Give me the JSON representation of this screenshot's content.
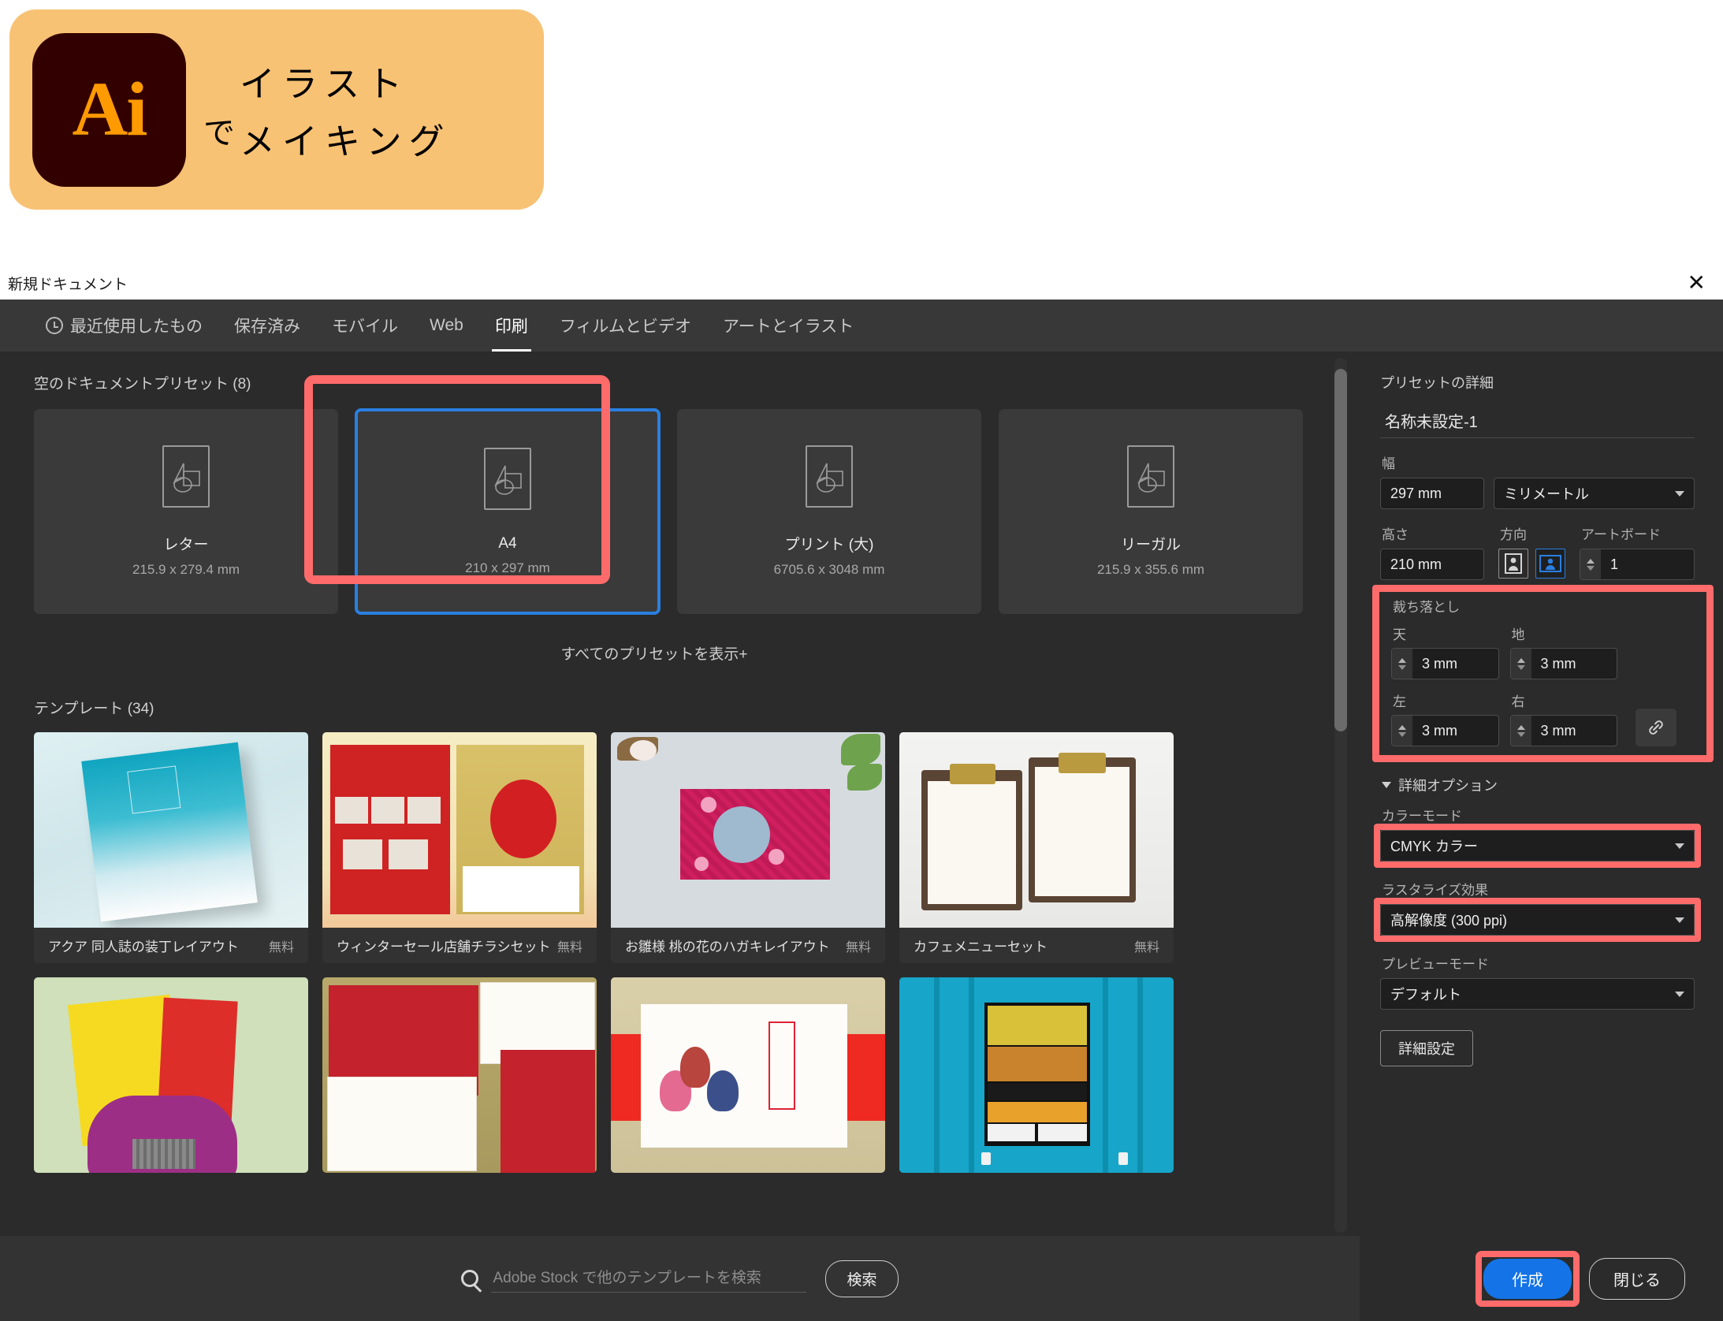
{
  "banner": {
    "logo_text": "Ai",
    "particle": "で",
    "line1": "イラスト",
    "line2": "メイキング",
    "bg_color": "#f8c274",
    "logo_bg": "#330000",
    "logo_fg": "#ff9a00"
  },
  "dialog": {
    "title": "新規ドキュメント",
    "close_icon": "✕"
  },
  "tabs": [
    {
      "label": "最近使用したもの",
      "icon": "clock-icon",
      "active": false
    },
    {
      "label": "保存済み",
      "active": false
    },
    {
      "label": "モバイル",
      "active": false
    },
    {
      "label": "Web",
      "active": false
    },
    {
      "label": "印刷",
      "active": true
    },
    {
      "label": "フィルムとビデオ",
      "active": false
    },
    {
      "label": "アートとイラスト",
      "active": false
    }
  ],
  "presets": {
    "heading": "空のドキュメントプリセット (8)",
    "show_all": "すべてのプリセットを表示+",
    "items": [
      {
        "name": "レター",
        "size": "215.9 x 279.4 mm",
        "selected": false
      },
      {
        "name": "A4",
        "size": "210 x 297 mm",
        "selected": true
      },
      {
        "name": "プリント (大)",
        "size": "6705.6 x 3048 mm",
        "selected": false
      },
      {
        "name": "リーガル",
        "size": "215.9 x 355.6 mm",
        "selected": false
      }
    ]
  },
  "templates": {
    "heading": "テンプレート (34)",
    "row1": [
      {
        "title": "アクア 同人誌の装丁レイアウト",
        "price": "無料"
      },
      {
        "title": "ウィンターセール店舗チラシセット",
        "price": "無料"
      },
      {
        "title": "お雛様 桃の花のハガキレイアウト",
        "price": "無料"
      },
      {
        "title": "カフェメニューセット",
        "price": "無料"
      }
    ],
    "row2": [
      {
        "title": "",
        "price": ""
      },
      {
        "title": "",
        "price": ""
      },
      {
        "title": "",
        "price": ""
      },
      {
        "title": "",
        "price": ""
      }
    ]
  },
  "details": {
    "heading": "プリセットの詳細",
    "doc_name": "名称未設定-1",
    "width_label": "幅",
    "width_value": "297 mm",
    "unit_value": "ミリメートル",
    "height_label": "高さ",
    "height_value": "210 mm",
    "orientation_label": "方向",
    "orientation_portrait_icon": "portrait-icon",
    "orientation_landscape_icon": "landscape-icon",
    "orientation_selected": "landscape",
    "artboard_label": "アートボード",
    "artboard_value": "1",
    "bleed": {
      "heading": "裁ち落とし",
      "top_label": "天",
      "top_value": "3 mm",
      "bottom_label": "地",
      "bottom_value": "3 mm",
      "left_label": "左",
      "left_value": "3 mm",
      "right_label": "右",
      "right_value": "3 mm",
      "link_icon": "link-icon"
    },
    "advanced_heading": "詳細オプション",
    "color_mode_label": "カラーモード",
    "color_mode_value": "CMYK カラー",
    "raster_label": "ラスタライズ効果",
    "raster_value": "高解像度 (300 ppi)",
    "preview_label": "プレビューモード",
    "preview_value": "デフォルト",
    "advanced_settings_button": "詳細設定"
  },
  "footer": {
    "search_placeholder": "Adobe Stock で他のテンプレートを検索",
    "search_button": "検索",
    "create_button": "作成",
    "close_button": "閉じる"
  },
  "colors": {
    "highlight": "#ff6b6b",
    "accent_blue": "#1473e6",
    "selection_blue": "#2a7fe0",
    "dialog_bg": "#2b2b2b",
    "tab_bg": "#383838"
  }
}
